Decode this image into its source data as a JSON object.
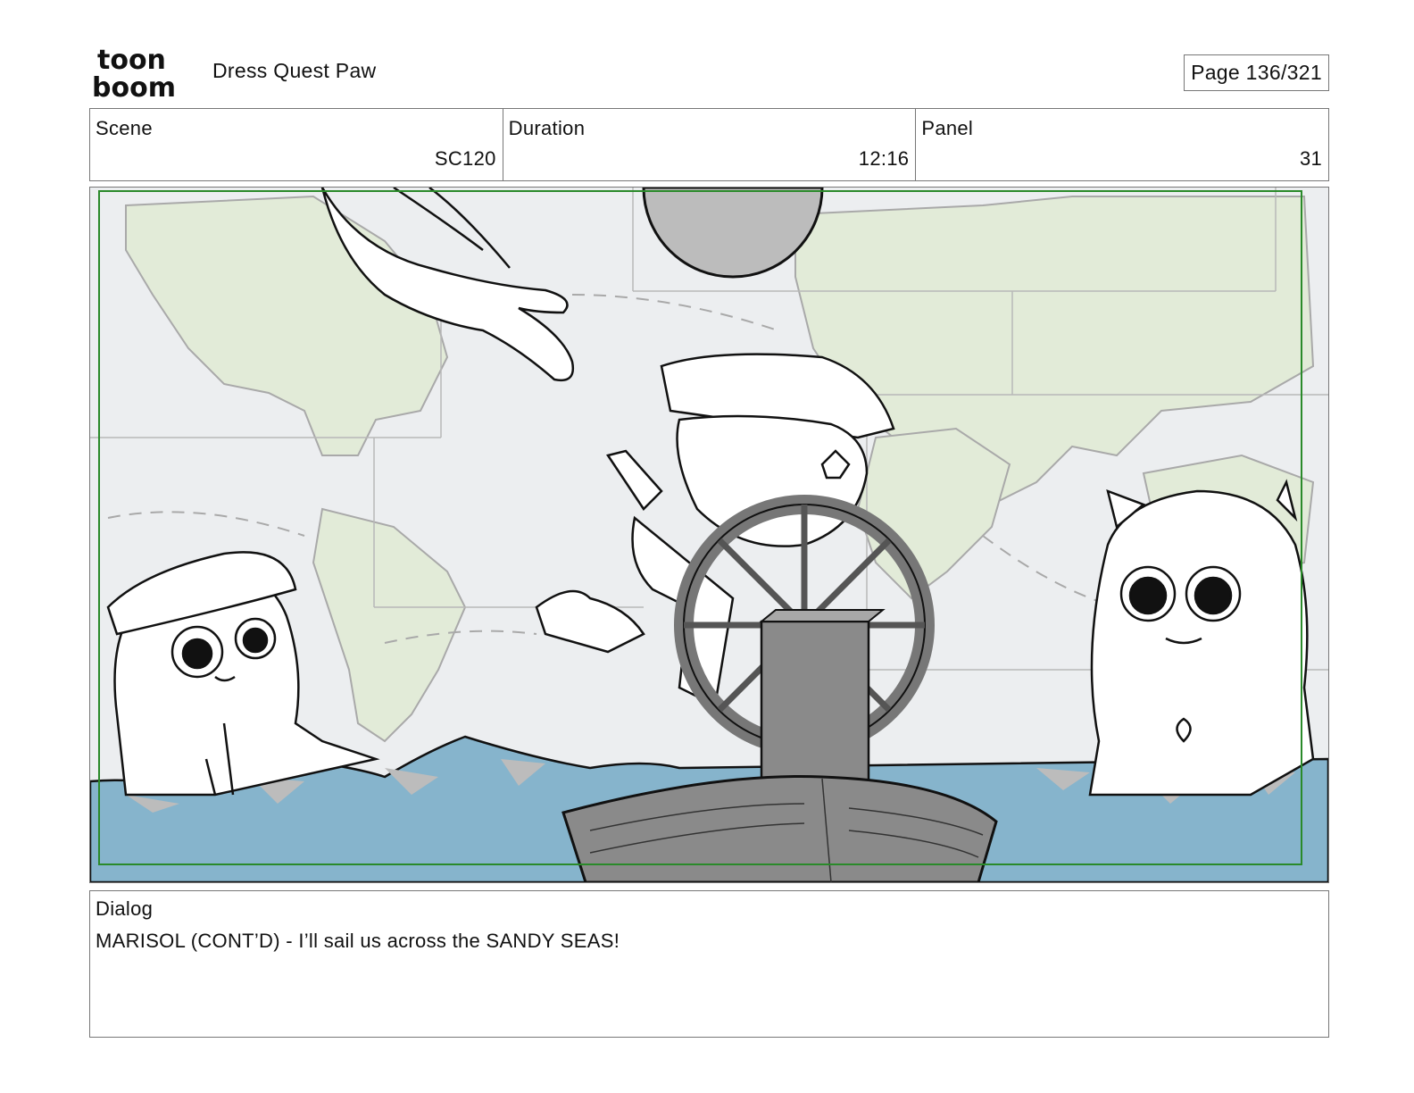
{
  "header": {
    "logo_text_top": "toon",
    "logo_text_bottom": "boom",
    "project_title": "Dress Quest Paw",
    "page_indicator": "Page 136/321"
  },
  "info": {
    "scene_label": "Scene",
    "scene_value": "SC120",
    "duration_label": "Duration",
    "duration_value": "12:16",
    "panel_label": "Panel",
    "panel_value": "31"
  },
  "panel": {
    "colors": {
      "map_land": "#e2ebd8",
      "map_sea": "#eceef0",
      "water": "#86b4cc",
      "boat": "#8a8a8a",
      "safe_frame": "#2a8a2a"
    }
  },
  "dialog": {
    "label": "Dialog",
    "text": "MARISOL (CONT’D) - I’ll sail us across the SANDY SEAS!"
  }
}
